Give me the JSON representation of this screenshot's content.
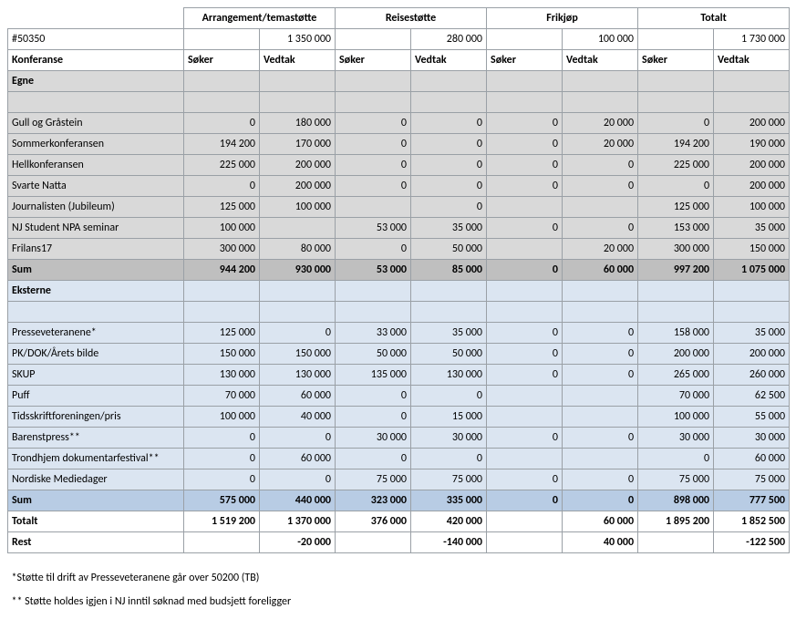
{
  "header": {
    "groups": [
      "Arrangement/temastøtte",
      "Reisestøtte",
      "Frikjøp",
      "Totalt"
    ],
    "ref": "#50350",
    "budget": [
      "1 350 000",
      "280 000",
      "100 000",
      "1 730 000"
    ],
    "conf_label": "Konferanse",
    "subcols": [
      "Søker",
      "Vedtak",
      "Søker",
      "Vedtak",
      "Søker",
      "Vedtak",
      "Søker",
      "Vedtak"
    ]
  },
  "egne": {
    "label": "Egne",
    "rows": [
      {
        "n": "Gull og Gråstein",
        "v": [
          "0",
          "180 000",
          "0",
          "0",
          "0",
          "20 000",
          "0",
          "200 000"
        ]
      },
      {
        "n": "Sommerkonferansen",
        "v": [
          "194 200",
          "170 000",
          "0",
          "0",
          "0",
          "20 000",
          "194 200",
          "190 000"
        ]
      },
      {
        "n": "Hellkonferansen",
        "v": [
          "225 000",
          "200 000",
          "0",
          "0",
          "0",
          "0",
          "225 000",
          "200 000"
        ]
      },
      {
        "n": "Svarte Natta",
        "v": [
          "0",
          "200 000",
          "0",
          "0",
          "0",
          "0",
          "0",
          "200 000"
        ]
      },
      {
        "n": "Journalisten (Jubileum)",
        "v": [
          "125 000",
          "100 000",
          "",
          "0",
          "",
          "",
          "125 000",
          "100 000"
        ]
      },
      {
        "n": "NJ Student NPA seminar",
        "v": [
          "100 000",
          "",
          "53 000",
          "35 000",
          "0",
          "0",
          "153 000",
          "35 000"
        ]
      },
      {
        "n": "Frilans17",
        "v": [
          "300 000",
          "80 000",
          "0",
          "50 000",
          "",
          "20 000",
          "300 000",
          "150 000"
        ]
      }
    ],
    "sum_label": "Sum",
    "sum": [
      "944 200",
      "930 000",
      "53 000",
      "85 000",
      "0",
      "60 000",
      "997 200",
      "1 075 000"
    ]
  },
  "eksterne": {
    "label": "Eksterne",
    "rows": [
      {
        "n": "Presseveteranene*",
        "v": [
          "125 000",
          "0",
          "33 000",
          "35 000",
          "0",
          "0",
          "158 000",
          "35 000"
        ]
      },
      {
        "n": "PK/DOK/Årets bilde",
        "v": [
          "150 000",
          "150 000",
          "50 000",
          "50 000",
          "0",
          "0",
          "200 000",
          "200 000"
        ]
      },
      {
        "n": "SKUP",
        "v": [
          "130 000",
          "130 000",
          "135 000",
          "130 000",
          "0",
          "0",
          "265 000",
          "260 000"
        ]
      },
      {
        "n": "Puff",
        "v": [
          "70 000",
          "60 000",
          "0",
          "0",
          "",
          "",
          "70 000",
          "62 500"
        ]
      },
      {
        "n": "Tidsskriftforeningen/pris",
        "v": [
          "100 000",
          "40 000",
          "0",
          "15 000",
          "",
          "",
          "100 000",
          "55 000"
        ]
      },
      {
        "n": "Barenstpress**",
        "v": [
          "0",
          "0",
          "30 000",
          "30 000",
          "0",
          "0",
          "30 000",
          "30 000"
        ]
      },
      {
        "n": "Trondhjem dokumentarfestival**",
        "v": [
          "0",
          "60 000",
          "0",
          "0",
          "",
          "",
          "0",
          "60 000"
        ]
      },
      {
        "n": "Nordiske Mediedager",
        "v": [
          "0",
          "0",
          "75 000",
          "75 000",
          "0",
          "0",
          "75 000",
          "75 000"
        ]
      }
    ],
    "sum_label": "Sum",
    "sum": [
      "575 000",
      "440 000",
      "323 000",
      "335 000",
      "0",
      "0",
      "898 000",
      "777 500"
    ]
  },
  "totalt": {
    "label": "Totalt",
    "v": [
      "1 519 200",
      "1 370 000",
      "376 000",
      "420 000",
      "",
      "60 000",
      "1 895 200",
      "1 852 500"
    ]
  },
  "rest": {
    "label": "Rest",
    "v": [
      "",
      "-20 000",
      "",
      "-140 000",
      "",
      "40 000",
      "",
      "-122 500"
    ]
  },
  "footnotes": [
    "*Støtte til drift av Presseveteranene går over 50200 (TB)",
    "** Støtte holdes igjen i NJ inntil søknad med budsjett foreligger"
  ]
}
